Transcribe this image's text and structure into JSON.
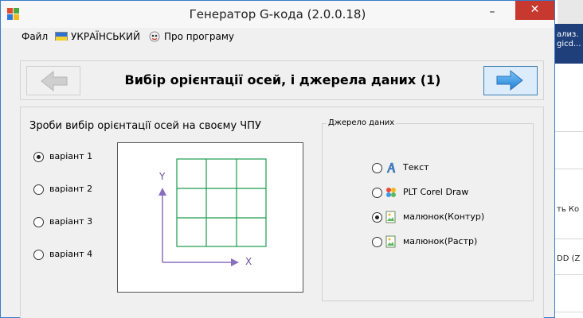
{
  "window": {
    "title": "Генератор G-кода (2.0.0.18)",
    "minimize": "–",
    "close": "✕"
  },
  "menu": {
    "file": "Файл",
    "language": "УКРАЇНСЬКИЙ",
    "about": "Про програму"
  },
  "header": {
    "title": "Вибір орієнтації осей, і джерела даних (1)"
  },
  "axes": {
    "heading": "Зроби вибір орієнтації осей на своєму ЧПУ",
    "options": [
      {
        "label": "варіант 1",
        "selected": true
      },
      {
        "label": "варіант 2",
        "selected": false
      },
      {
        "label": "варіант 3",
        "selected": false
      },
      {
        "label": "варіант 4",
        "selected": false
      }
    ],
    "y_label": "Y",
    "x_label": "X"
  },
  "source": {
    "legend": "Джерело даних",
    "options": [
      {
        "label": "Текст",
        "selected": false,
        "icon": "text-icon"
      },
      {
        "label": "PLT Corel Draw",
        "selected": false,
        "icon": "plt-icon"
      },
      {
        "label": "малюнок(Контур)",
        "selected": true,
        "icon": "image-icon"
      },
      {
        "label": "малюнок(Растр)",
        "selected": false,
        "icon": "image-icon"
      }
    ]
  },
  "background": {
    "snippet1": "ализ.",
    "snippet2": "gicd...",
    "snippet3": "ть Ко",
    "snippet4": "DD (Z"
  },
  "colors": {
    "grid": "#1a9b4e",
    "axis": "#8a6fbf",
    "arrow": "#2e8fe0",
    "close": "#c7392f"
  }
}
